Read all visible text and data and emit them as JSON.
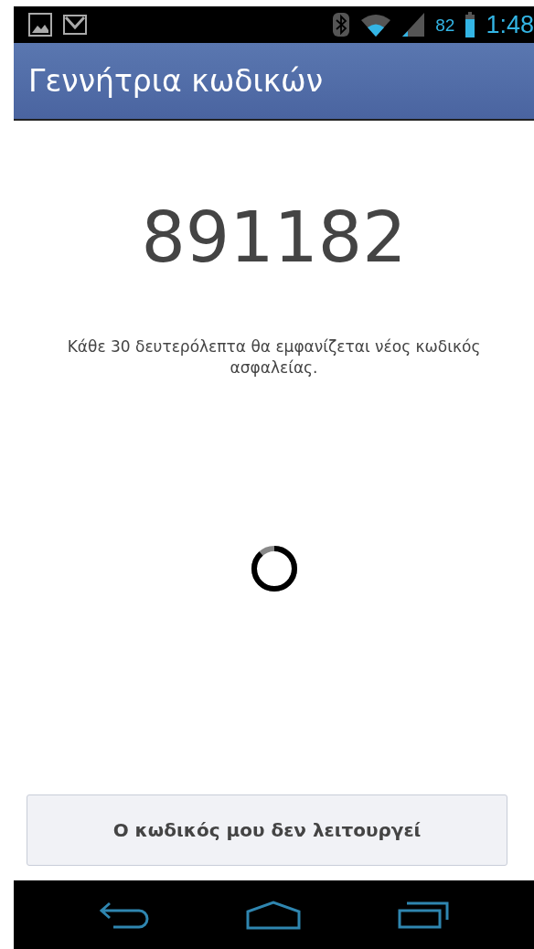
{
  "status_bar": {
    "battery_percent": "82",
    "time": "1:48"
  },
  "action_bar": {
    "title": "Γεννήτρια κωδικών"
  },
  "code": "891182",
  "description": "Κάθε 30 δευτερόλεπτα θα εμφανίζεται νέος κωδικός ασφαλείας.",
  "button": {
    "label": "Ο κωδικός μου δεν λειτουργεί"
  }
}
